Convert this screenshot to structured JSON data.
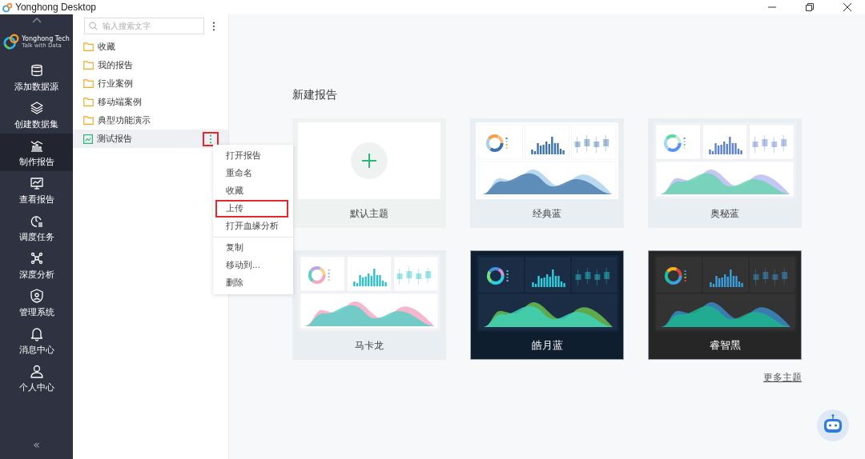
{
  "window": {
    "title": "Yonghong Desktop"
  },
  "nav": {
    "logo_name": "Yonghong Tech",
    "logo_slogan": "Talk with Data",
    "collapse": "«",
    "items": [
      {
        "label": "添加数据源",
        "selected": false
      },
      {
        "label": "创建数据集",
        "selected": false
      },
      {
        "label": "制作报告",
        "selected": true
      },
      {
        "label": "查看报告",
        "selected": false
      },
      {
        "label": "调度任务",
        "selected": false
      },
      {
        "label": "深度分析",
        "selected": false
      },
      {
        "label": "管理系统",
        "selected": false
      },
      {
        "label": "消息中心",
        "selected": false
      },
      {
        "label": "个人中心",
        "selected": false
      }
    ]
  },
  "tree": {
    "search": {
      "placeholder": "输入搜索文字"
    },
    "items": [
      {
        "label": "收藏",
        "kind": "folder",
        "selected": false
      },
      {
        "label": "我的报告",
        "kind": "folder",
        "selected": false
      },
      {
        "label": "行业案例",
        "kind": "folder",
        "selected": false
      },
      {
        "label": "移动端案例",
        "kind": "folder",
        "selected": false
      },
      {
        "label": "典型功能演示",
        "kind": "folder",
        "selected": false
      },
      {
        "label": "测试报告",
        "kind": "report",
        "selected": true,
        "outlined": true
      }
    ]
  },
  "context_menu": {
    "groups": [
      [
        {
          "label": "打开报告",
          "outlined": false
        },
        {
          "label": "重命名",
          "outlined": false
        },
        {
          "label": "收藏",
          "outlined": false
        },
        {
          "label": "上传",
          "outlined": true
        },
        {
          "label": "打开血缘分析",
          "outlined": false
        }
      ],
      [
        {
          "label": "复制",
          "outlined": false
        },
        {
          "label": "移动到...",
          "outlined": false
        },
        {
          "label": "删除",
          "outlined": false
        }
      ]
    ]
  },
  "new_report": {
    "title": "新建报告",
    "themes": [
      {
        "name": "默认主题",
        "kind": "blank"
      },
      {
        "name": "经典蓝",
        "kind": "blue"
      },
      {
        "name": "奥秘蓝",
        "kind": "mint"
      },
      {
        "name": "马卡龙",
        "kind": "macaron"
      },
      {
        "name": "皓月蓝",
        "kind": "navy"
      },
      {
        "name": "睿智黑",
        "kind": "black"
      }
    ],
    "more_link": "更多主题"
  }
}
